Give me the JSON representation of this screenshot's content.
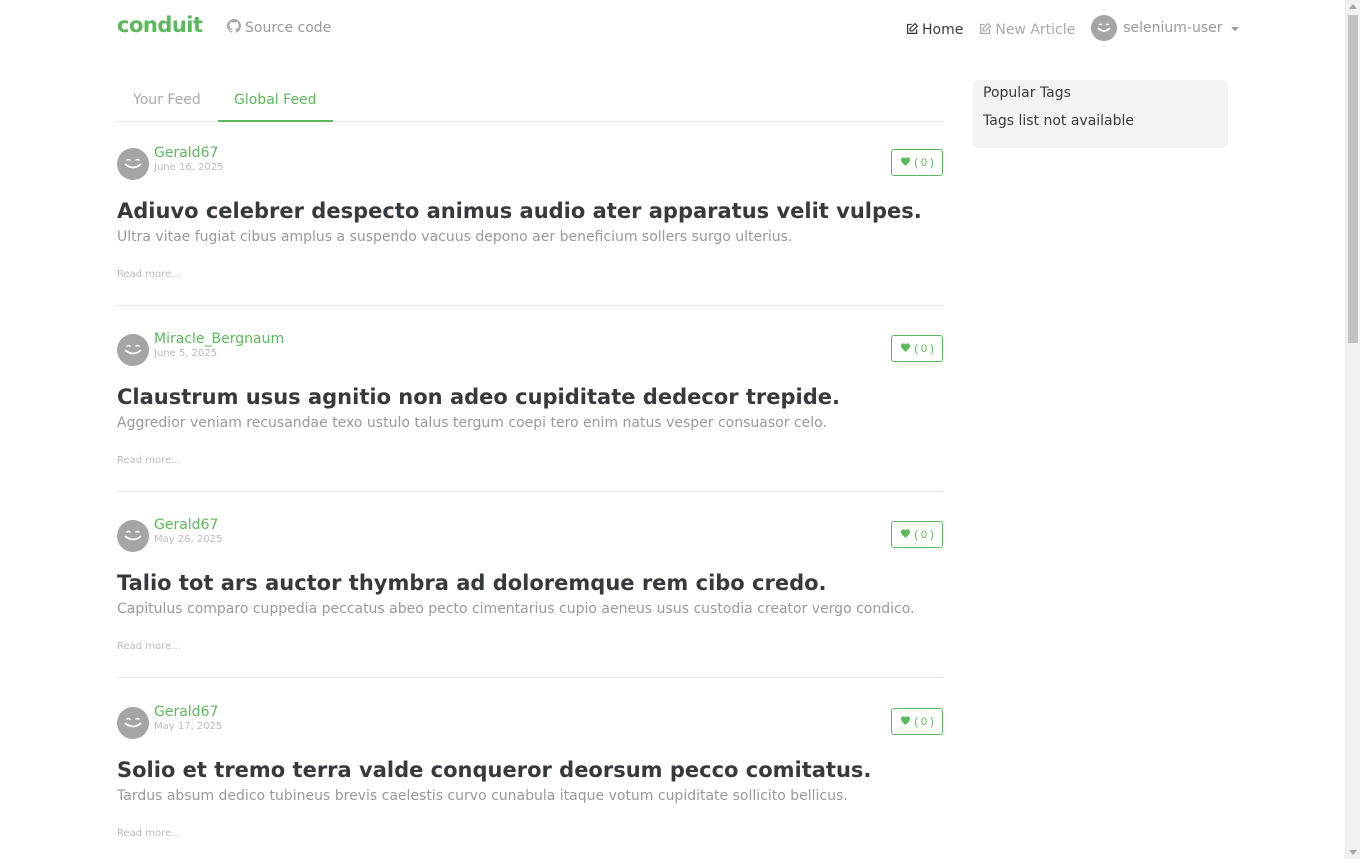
{
  "navbar": {
    "brand": "conduit",
    "source_label": "Source code",
    "home_label": "Home",
    "new_article_label": "New Article",
    "username": "selenium-user"
  },
  "tabs": {
    "your_feed": "Your Feed",
    "global_feed": "Global Feed"
  },
  "sidebar": {
    "title": "Popular Tags",
    "message": "Tags list not available"
  },
  "articles": [
    {
      "author": "Gerald67",
      "date": "June 16, 2025",
      "favorites": "( 0 )",
      "title": "Adiuvo celebrer despecto animus audio ater apparatus velit vulpes.",
      "description": "Ultra vitae fugiat cibus amplus a suspendo vacuus depono aer beneficium sollers surgo ulterius.",
      "read_more": "Read more..."
    },
    {
      "author": "Miracle_Bergnaum",
      "date": "June 5, 2025",
      "favorites": "( 0 )",
      "title": "Claustrum usus agnitio non adeo cupiditate dedecor trepide.",
      "description": "Aggredior veniam recusandae texo ustulo talus tergum coepi tero enim natus vesper consuasor celo.",
      "read_more": "Read more..."
    },
    {
      "author": "Gerald67",
      "date": "May 26, 2025",
      "favorites": "( 0 )",
      "title": "Talio tot ars auctor thymbra ad doloremque rem cibo credo.",
      "description": "Capitulus comparo cuppedia peccatus abeo pecto cimentarius cupio aeneus usus custodia creator vergo condico.",
      "read_more": "Read more..."
    },
    {
      "author": "Gerald67",
      "date": "May 17, 2025",
      "favorites": "( 0 )",
      "title": "Solio et tremo terra valde conqueror deorsum pecco comitatus.",
      "description": "Tardus absum dedico tubineus brevis caelestis curvo cunabula itaque votum cupiditate sollicito bellicus.",
      "read_more": "Read more..."
    }
  ],
  "colors": {
    "accent": "#5cb85c",
    "text": "#373a3c",
    "muted": "#999999"
  }
}
